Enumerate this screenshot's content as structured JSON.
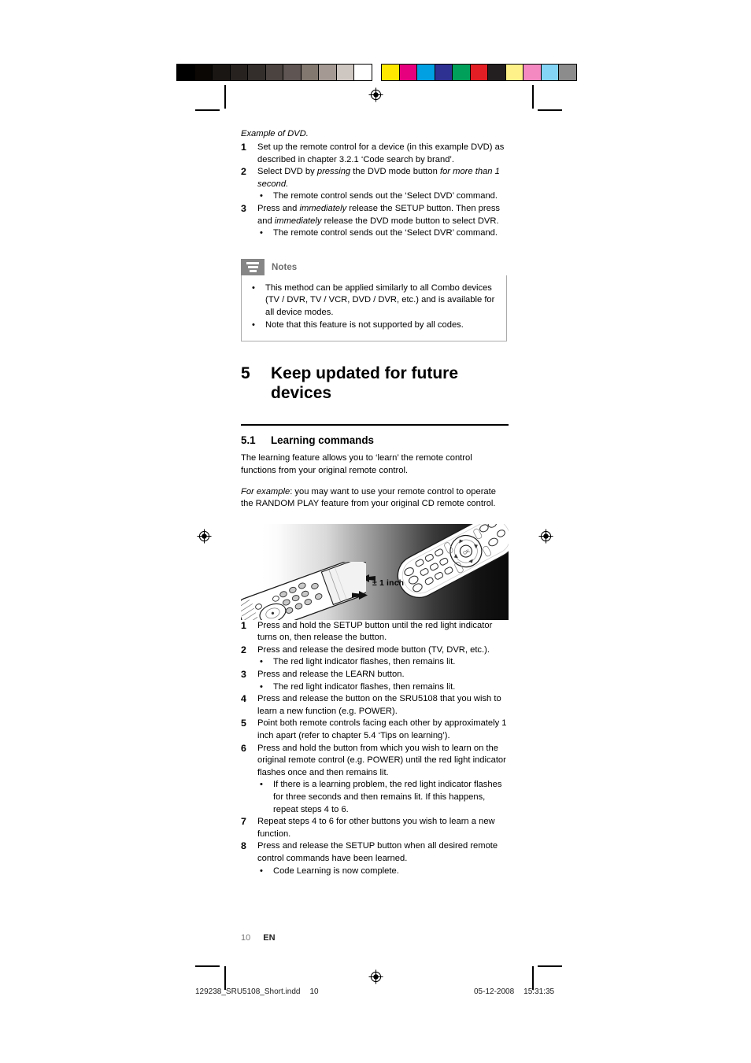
{
  "document": {
    "title": "Philips SRU5108 Short User Manual — page 10"
  },
  "calibration": {
    "grayscale": [
      "#000000",
      "#0a0705",
      "#1a1613",
      "#272220",
      "#332d2b",
      "#4a433f",
      "#5f5653",
      "#82786f",
      "#a49a93",
      "#cec6c1",
      "#ffffff"
    ],
    "colors": [
      "#ffe800",
      "#e6007e",
      "#00a0e3",
      "#2e3192",
      "#00a05a",
      "#e31e24",
      "#231f20",
      "#fff189",
      "#f389c0",
      "#84d5f5",
      "#8c8c8c"
    ]
  },
  "top_steps": {
    "intro": "Example of DVD.",
    "items": [
      {
        "num": "1",
        "lines": [
          {
            "runs": [
              {
                "t": "Set up the remote control for a device (in this example DVD) as described in chapter 3.2.1 ‘Code search by brand’.",
                "i": false
              }
            ]
          }
        ],
        "bullets": []
      },
      {
        "num": "2",
        "lines": [
          {
            "runs": [
              {
                "t": "Select DVD by ",
                "i": false
              },
              {
                "t": "pressing",
                "i": true
              },
              {
                "t": " the DVD mode button ",
                "i": false
              },
              {
                "t": "for more than 1 second.",
                "i": true
              }
            ]
          }
        ],
        "bullets": [
          "The remote control sends out the ‘Select DVD’ command."
        ]
      },
      {
        "num": "3",
        "lines": [
          {
            "runs": [
              {
                "t": "Press and ",
                "i": false
              },
              {
                "t": "immediately",
                "i": true
              },
              {
                "t": " release the SETUP button. Then press and ",
                "i": false
              },
              {
                "t": "immediately",
                "i": true
              },
              {
                "t": " release the DVD mode button to select DVR.",
                "i": false
              }
            ]
          }
        ],
        "bullets": [
          "The remote control sends out the ‘Select DVR’ command."
        ]
      }
    ]
  },
  "notes": {
    "icon": "notes-list-icon",
    "title": "Notes",
    "items": [
      "This method can be applied similarly to all Combo devices (TV / DVR, TV / VCR, DVD / DVR, etc.) and is available for all device modes.",
      "Note that this feature is not supported by all codes."
    ]
  },
  "chapter": {
    "number": "5",
    "title": "Keep updated for future devices"
  },
  "section": {
    "number": "5.1",
    "title": "Learning commands",
    "paragraph_1": "The learning feature allows you to ‘learn’ the remote control functions from your original remote control.",
    "paragraph_2_italic": "For example",
    "paragraph_2_rest": ": you may want to use your remote control to operate the RANDOM PLAY feature from your original CD remote control."
  },
  "illustration": {
    "name": "two-remote-controls-facing-each-other",
    "distance_label": "± 1 inch",
    "left_remote": "sru5108-universal-remote",
    "right_remote": "original-remote-control",
    "arrow_left": "arrow-pointing-left",
    "arrow_right": "arrow-pointing-right"
  },
  "learning_steps": {
    "items": [
      {
        "num": "1",
        "text": "Press and hold the SETUP button until the red light indicator turns on, then release the button.",
        "bullets": []
      },
      {
        "num": "2",
        "text": "Press and release the desired mode button (TV, DVR, etc.).",
        "bullets": [
          "The red light indicator flashes, then remains lit."
        ]
      },
      {
        "num": "3",
        "text": "Press and release the LEARN button.",
        "bullets": [
          "The red light indicator flashes, then remains lit."
        ]
      },
      {
        "num": "4",
        "text": "Press and release the button on the SRU5108 that you wish to learn a new function (e.g. POWER).",
        "bullets": []
      },
      {
        "num": "5",
        "text": "Point both remote controls facing each other by approximately 1 inch apart (refer to chapter 5.4 ‘Tips on learning’).",
        "bullets": []
      },
      {
        "num": "6",
        "text": "Press and hold the button from which you wish to learn on the original remote control (e.g. POWER) until the red light indicator flashes once and then remains lit.",
        "bullets": [
          "If there is a learning problem, the red light indicator flashes for three seconds and then remains lit. If this happens, repeat steps 4 to 6."
        ]
      },
      {
        "num": "7",
        "text": "Repeat steps 4 to 6 for other buttons you wish to learn a new function.",
        "bullets": []
      },
      {
        "num": "8",
        "text": "Press and release the SETUP button when all desired remote control commands have been learned.",
        "bullets": [
          "Code Learning is now complete."
        ]
      }
    ]
  },
  "footer": {
    "page_number": "10",
    "language": "EN"
  },
  "print_footer": {
    "filename": "129238_SRU5108_Short.indd",
    "page": "10",
    "date": "05-12-2008",
    "time": "15:31:35"
  }
}
